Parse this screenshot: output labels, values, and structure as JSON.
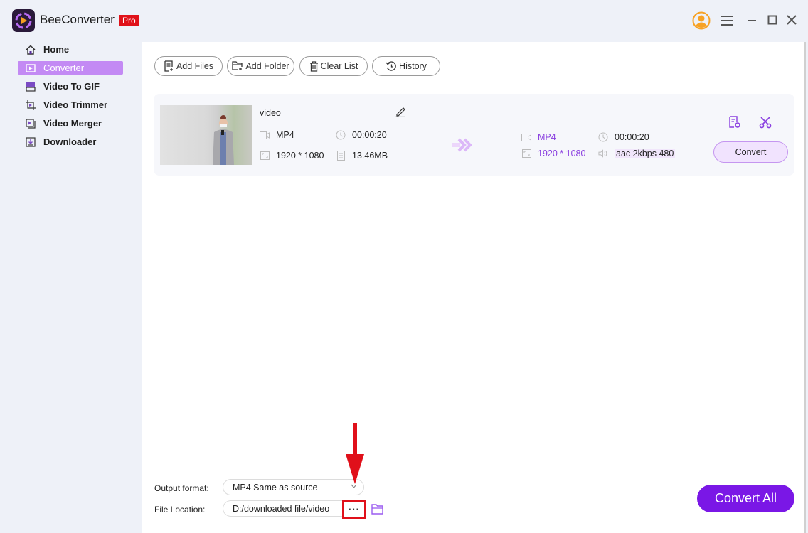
{
  "app": {
    "title": "BeeConverter",
    "badge": "Pro"
  },
  "window_controls": {
    "icons": [
      "user-avatar-icon",
      "menu-icon",
      "minimize-icon",
      "maximize-icon",
      "close-icon"
    ]
  },
  "sidebar": {
    "items": [
      {
        "label": "Home",
        "icon": "home-icon",
        "active": false
      },
      {
        "label": "Converter",
        "icon": "converter-icon",
        "active": true
      },
      {
        "label": "Video To GIF",
        "icon": "gif-icon",
        "active": false
      },
      {
        "label": "Video Trimmer",
        "icon": "trim-icon",
        "active": false
      },
      {
        "label": "Video Merger",
        "icon": "merge-icon",
        "active": false
      },
      {
        "label": "Downloader",
        "icon": "download-icon",
        "active": false
      }
    ]
  },
  "toolbar": {
    "add_files": "Add Files",
    "add_folder": "Add Folder",
    "clear_list": "Clear List",
    "history": "History"
  },
  "file": {
    "name": "video",
    "source": {
      "format": "MP4",
      "duration": "00:00:20",
      "resolution": "1920 * 1080",
      "size": "13.46MB"
    },
    "output": {
      "format": "MP4",
      "duration": "00:00:20",
      "resolution": "1920 * 1080",
      "audio": "aac 2kbps 480"
    },
    "convert_label": "Convert"
  },
  "bottom": {
    "output_format_label": "Output format:",
    "output_format_value": "MP4 Same as source",
    "file_location_label": "File Location:",
    "file_location_value": "D:/downloaded file/video",
    "browse_label": "···",
    "convert_all_label": "Convert All"
  },
  "colors": {
    "accent": "#7a17e6",
    "sidebar_active": "#c38af4",
    "pro_badge": "#e0121a",
    "annotation_red": "#e0101a",
    "user_icon": "#f7a225"
  }
}
